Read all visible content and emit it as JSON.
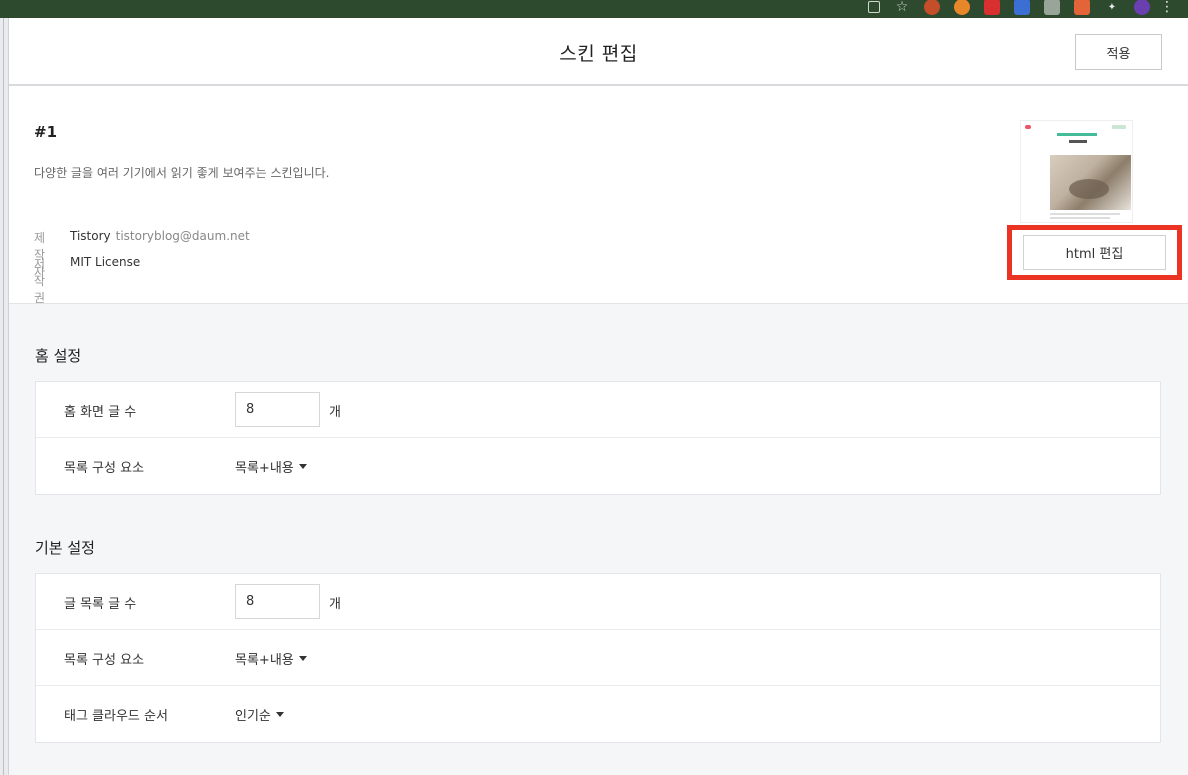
{
  "header": {
    "title": "스킨 편집",
    "apply_label": "적용"
  },
  "skin": {
    "name": "#1",
    "description": "다양한 글을 여러 기기에서 읽기 좋게 보여주는 스킨입니다.",
    "author_key": "제작자",
    "author_name": "Tistory",
    "author_email": "tistoryblog@daum.net",
    "license_key": "저작권",
    "license_value": "MIT License",
    "html_edit_label": "html 편집",
    "highlight_color": "#ea3323"
  },
  "home_settings": {
    "title": "홈 설정",
    "post_count_label": "홈 화면 글 수",
    "post_count_value": "8",
    "post_count_unit": "개",
    "list_element_label": "목록 구성 요소",
    "list_element_value": "목록+내용"
  },
  "basic_settings": {
    "title": "기본 설정",
    "post_count_label": "글 목록 글 수",
    "post_count_value": "8",
    "post_count_unit": "개",
    "list_element_label": "목록 구성 요소",
    "list_element_value": "목록+내용",
    "tag_order_label": "태그 클라우드 순서",
    "tag_order_value": "인기순"
  },
  "browser_extensions": [
    "share-icon",
    "bookmark-star-icon",
    "extension-icon",
    "extension-icon",
    "extension-icon",
    "extension-icon",
    "extension-icon",
    "extension-icon",
    "puzzle-icon",
    "profile-avatar",
    "more-menu-icon"
  ]
}
